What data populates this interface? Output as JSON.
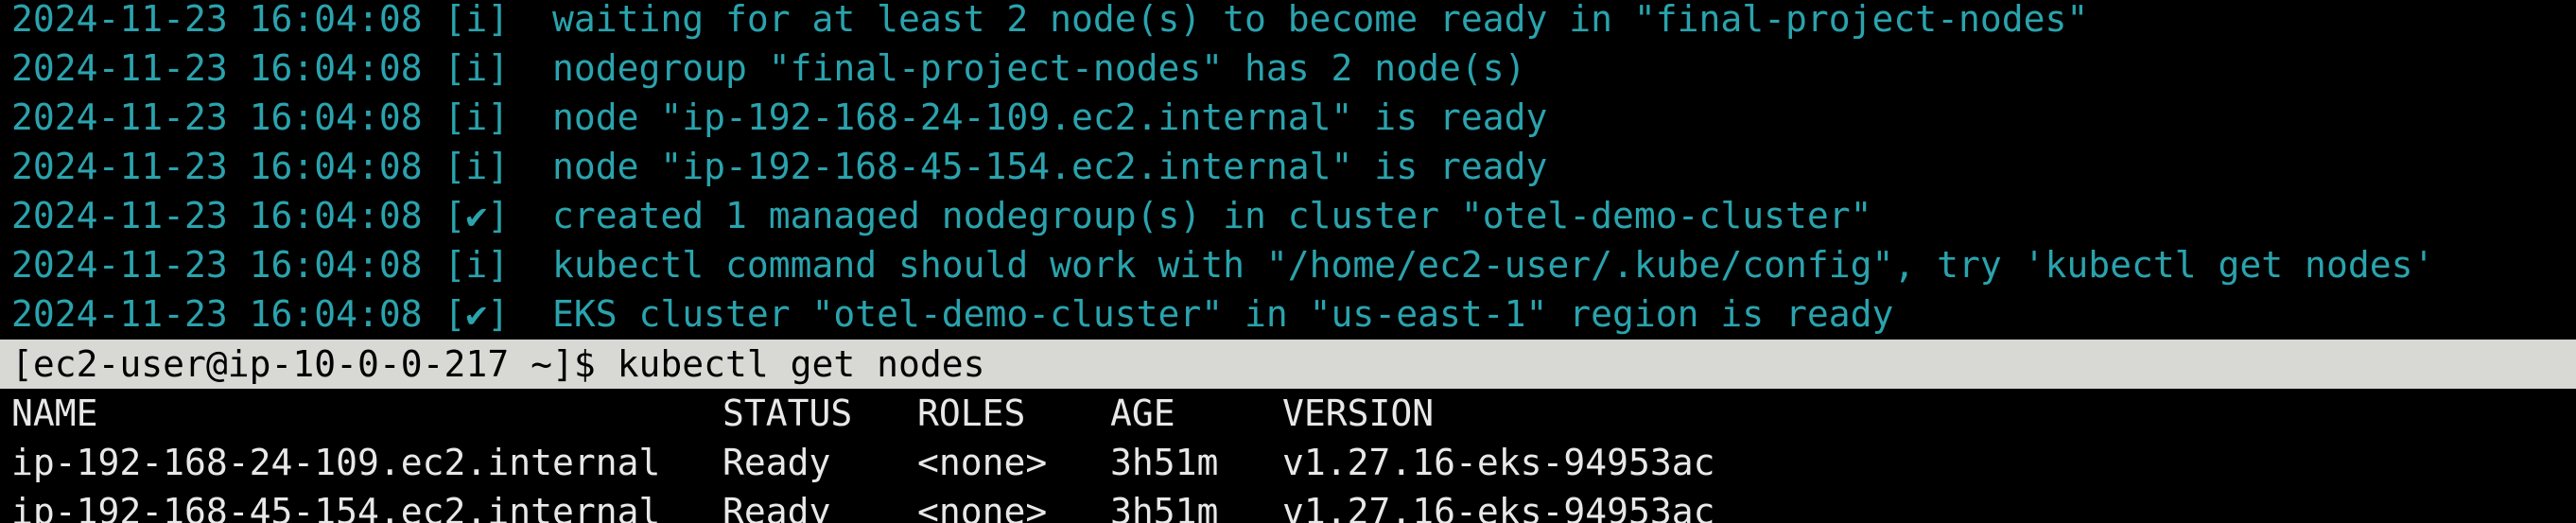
{
  "terminal": {
    "log_lines": [
      "2024-11-23 16:04:08 [i]  waiting for at least 2 node(s) to become ready in \"final-project-nodes\"",
      "2024-11-23 16:04:08 [i]  nodegroup \"final-project-nodes\" has 2 node(s)",
      "2024-11-23 16:04:08 [i]  node \"ip-192-168-24-109.ec2.internal\" is ready",
      "2024-11-23 16:04:08 [i]  node \"ip-192-168-45-154.ec2.internal\" is ready",
      "2024-11-23 16:04:08 [✔]  created 1 managed nodegroup(s) in cluster \"otel-demo-cluster\"",
      "2024-11-23 16:04:08 [i]  kubectl command should work with \"/home/ec2-user/.kube/config\", try 'kubectl get nodes'",
      "2024-11-23 16:04:08 [✔]  EKS cluster \"otel-demo-cluster\" in \"us-east-1\" region is ready"
    ],
    "prompt": "[ec2-user@ip-10-0-0-217 ~]$ ",
    "command": "kubectl get nodes",
    "table": {
      "headers": [
        "NAME",
        "STATUS",
        "ROLES",
        "AGE",
        "VERSION"
      ],
      "rows": [
        [
          "ip-192-168-24-109.ec2.internal",
          "Ready",
          "<none>",
          "3h51m",
          "v1.27.16-eks-94953ac"
        ],
        [
          "ip-192-168-45-154.ec2.internal",
          "Ready",
          "<none>",
          "3h51m",
          "v1.27.16-eks-94953ac"
        ]
      ]
    },
    "colors": {
      "background": "#000000",
      "log_text": "#2aa3ad",
      "prompt_highlight": "#d8d8d4",
      "output_text": "#e8e8e8"
    }
  }
}
